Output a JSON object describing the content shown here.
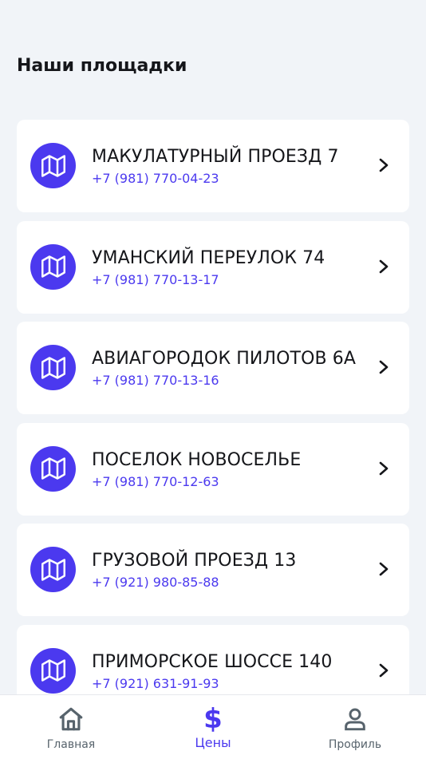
{
  "header": {
    "title": "Наши площадки"
  },
  "locations": [
    {
      "name": "МАКУЛАТУРНЫЙ ПРОЕЗД 7",
      "phone": "+7 (981) 770-04-23"
    },
    {
      "name": "УМАНСКИЙ ПЕРЕУЛОК 74",
      "phone": "+7 (981) 770-13-17"
    },
    {
      "name": "АВИАГОРОДОК ПИЛОТОВ 6А",
      "phone": "+7 (981) 770-13-16"
    },
    {
      "name": "ПОСЕЛОК НОВОСЕЛЬЕ",
      "phone": "+7 (981) 770-12-63"
    },
    {
      "name": "ГРУЗОВОЙ ПРОЕЗД 13",
      "phone": "+7 (921) 980-85-88"
    },
    {
      "name": "ПРИМОРСКОЕ ШОССЕ 140",
      "phone": "+7 (921) 631-91-93"
    }
  ],
  "icons": {
    "location": "map-icon",
    "arrow": "chevron-right-icon"
  },
  "nav": {
    "items": [
      {
        "label": "Главная",
        "icon": "home-icon",
        "active": false
      },
      {
        "label": "Цены",
        "icon": "dollar-icon",
        "active": true,
        "symbol": "$"
      },
      {
        "label": "Профиль",
        "icon": "person-icon",
        "active": false
      }
    ]
  },
  "colors": {
    "accent": "#4b39ef",
    "background": "#f1f4f8",
    "card": "#ffffff",
    "text": "#15161a",
    "secondary": "#57636c"
  }
}
